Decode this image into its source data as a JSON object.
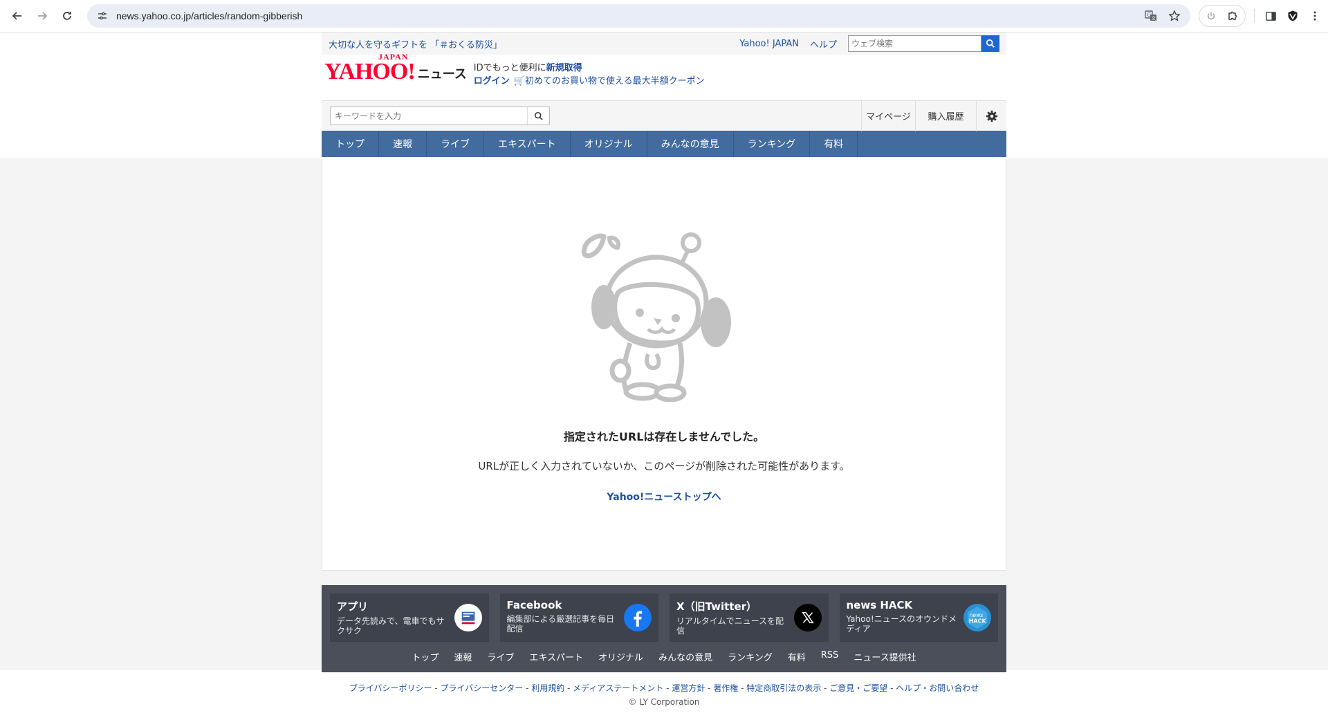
{
  "browser": {
    "url": "news.yahoo.co.jp/articles/random-gibberish"
  },
  "util": {
    "promo": "大切な人を守るギフトを 「＃おくる防災」",
    "yahoo_japan": "Yahoo! JAPAN",
    "help": "ヘルプ",
    "web_search_placeholder": "ウェブ検索"
  },
  "masthead": {
    "logo_text": "YAHOO!",
    "logo_sub": "JAPAN",
    "service": "ニュース",
    "id_text": "IDでもっと便利に",
    "signup": "新規取得",
    "login": "ログイン",
    "coupon": "初めてのお買い物で使える最大半額クーポン"
  },
  "search": {
    "placeholder": "キーワードを入力",
    "mypage": "マイページ",
    "history": "購入履歴"
  },
  "nav": {
    "items": [
      "トップ",
      "速報",
      "ライブ",
      "エキスパート",
      "オリジナル",
      "みんなの意見",
      "ランキング",
      "有料"
    ]
  },
  "error": {
    "title": "指定されたURLは存在しませんでした。",
    "desc": "URLが正しく入力されていないか、このページが削除された可能性があります。",
    "link": "Yahoo!ニューストップへ"
  },
  "footer": {
    "cards": [
      {
        "title": "アプリ",
        "desc": "データ先読みで、電車でもサクサク"
      },
      {
        "title": "Facebook",
        "desc": "編集部による厳選記事を毎日配信"
      },
      {
        "title": "X（旧Twitter）",
        "desc": "リアルタイムでニュースを配信"
      },
      {
        "title": "news HACK",
        "desc": "Yahoo!ニュースのオウンドメディア"
      }
    ],
    "links": [
      "トップ",
      "速報",
      "ライブ",
      "エキスパート",
      "オリジナル",
      "みんなの意見",
      "ランキング",
      "有料",
      "RSS",
      "ニュース提供社"
    ],
    "legal": [
      "プライバシーポリシー",
      "プライバシーセンター",
      "利用規約",
      "メディアステートメント",
      "運営方針",
      "著作権",
      "特定商取引法の表示",
      "ご意見・ご要望",
      "ヘルプ・お問い合わせ"
    ],
    "copyright": "© LY Corporation"
  },
  "colors": {
    "nav_bg": "#426b9e",
    "link": "#1e50a2",
    "brand_red": "#ff0033",
    "footer_bg": "#4a4f5a"
  }
}
